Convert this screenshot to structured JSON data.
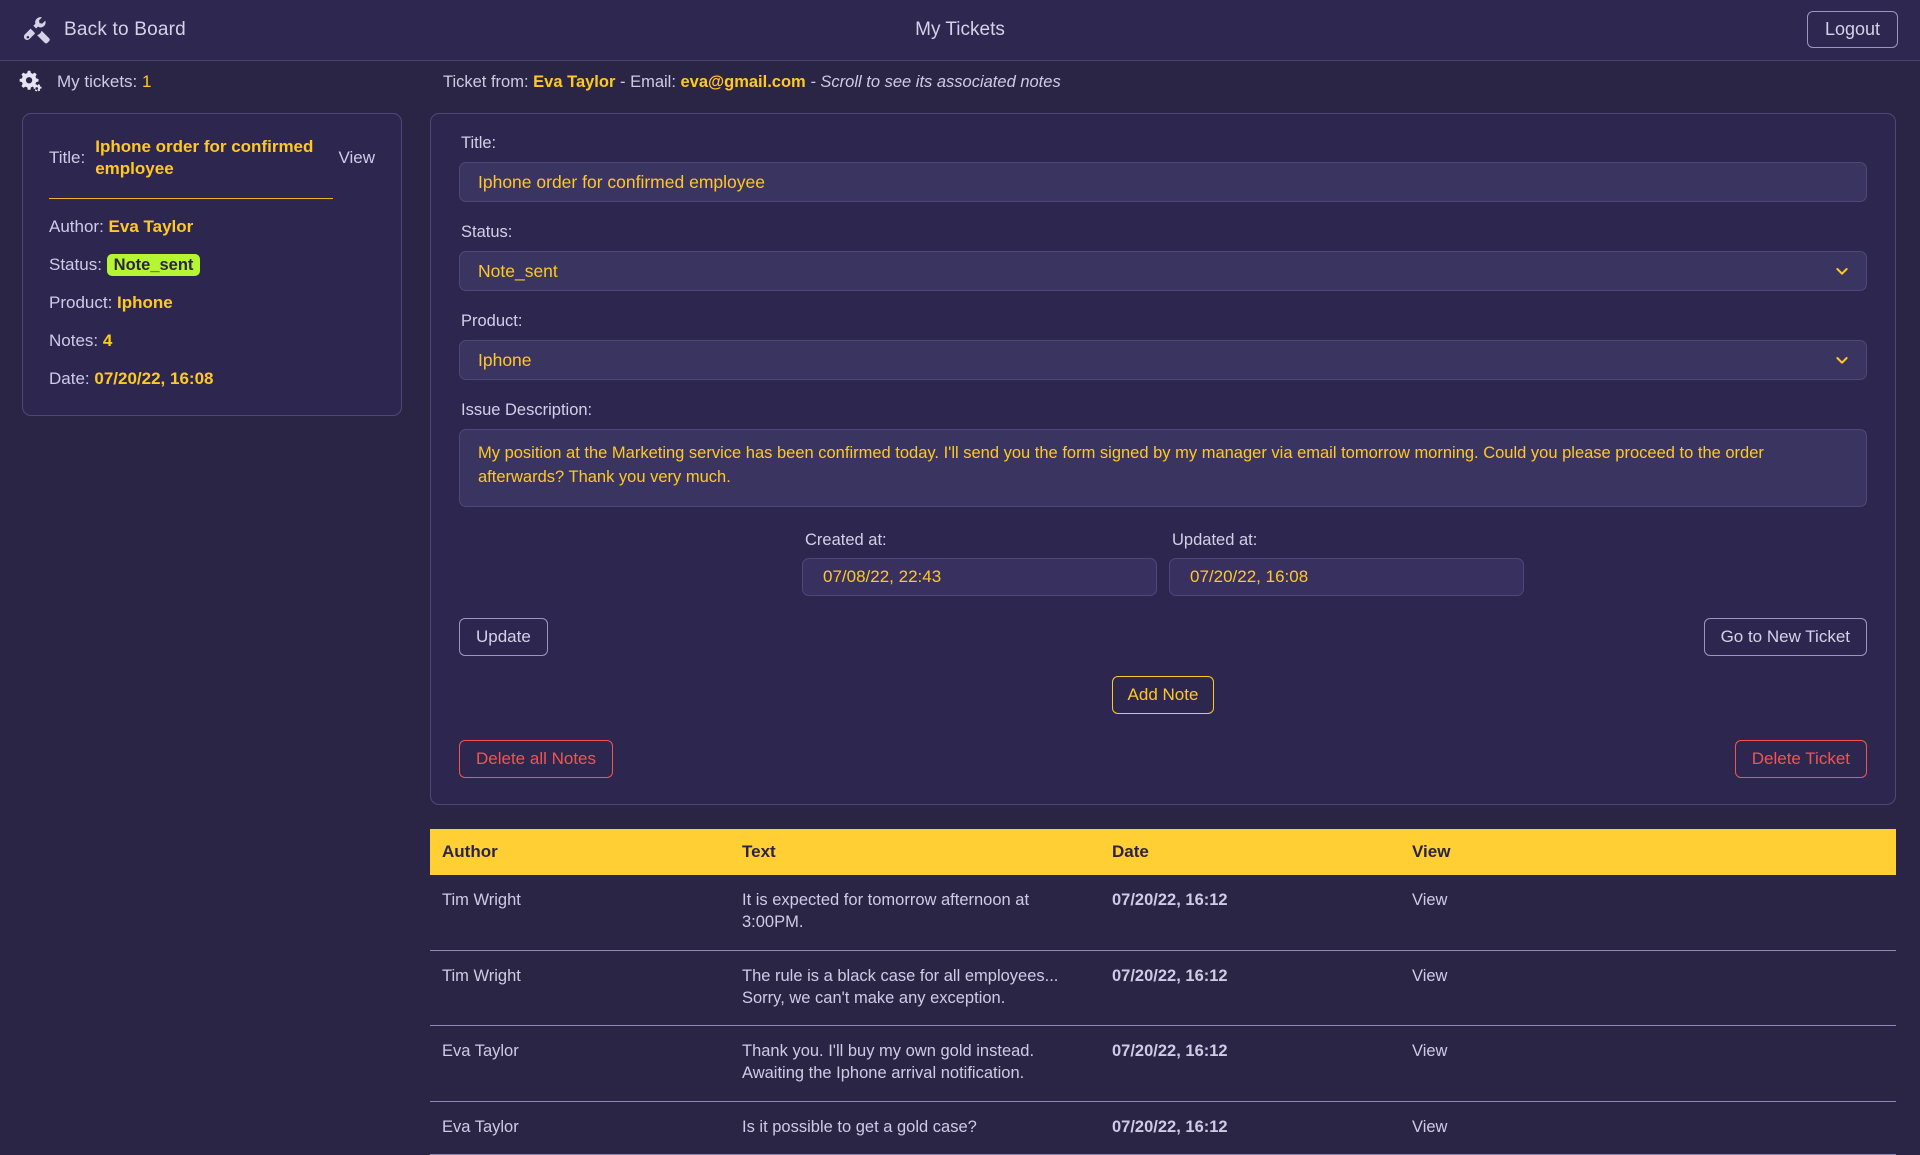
{
  "navbar": {
    "brand": "Back to Board",
    "title": "My Tickets",
    "logout_label": "Logout",
    "tools_icon": "tools-icon"
  },
  "subheader": {
    "gears_icon": "gears-icon",
    "my_tickets_label": "My tickets:",
    "my_tickets_count": "1",
    "ticket_from_prefix": "Ticket from:",
    "ticket_from_name": "Eva Taylor",
    "email_prefix": "- Email:",
    "email_value": "eva@gmail.com",
    "hint": "- Scroll to see its associated notes"
  },
  "sidebar": {
    "card": {
      "title_label": "Title:",
      "title_value": "Iphone order for confirmed employee",
      "view_label": "View",
      "author_label": "Author:",
      "author_value": "Eva Taylor",
      "status_label": "Status:",
      "status_value": "Note_sent",
      "product_label": "Product:",
      "product_value": "Iphone",
      "notes_label": "Notes:",
      "notes_value": "4",
      "date_label": "Date:",
      "date_value": "07/20/22, 16:08"
    }
  },
  "form": {
    "title_label": "Title:",
    "title_value": "Iphone order for confirmed employee",
    "status_label": "Status:",
    "status_value": "Note_sent",
    "status_options": [
      "Note_sent"
    ],
    "product_label": "Product:",
    "product_value": "Iphone",
    "product_options": [
      "Iphone"
    ],
    "description_label": "Issue Description:",
    "description_value": "My position at the Marketing service has been confirmed today. I'll send you the form signed by my manager via email tomorrow morning. Could you please proceed to the order afterwards? Thank you very much.",
    "created_at_label": "Created at:",
    "created_at_value": "07/08/22, 22:43",
    "updated_at_label": "Updated at:",
    "updated_at_value": "07/20/22, 16:08",
    "update_label": "Update",
    "go_new_ticket_label": "Go to New Ticket",
    "add_note_label": "Add Note",
    "delete_all_notes_label": "Delete all Notes",
    "delete_ticket_label": "Delete Ticket",
    "chevron_icon": "chevron-down-icon"
  },
  "notes_table": {
    "columns": [
      "Author",
      "Text",
      "Date",
      "View"
    ],
    "rows": [
      {
        "author": "Tim Wright",
        "text": "It is expected for tomorrow afternoon at 3:00PM.",
        "date": "07/20/22, 16:12",
        "view": "View"
      },
      {
        "author": "Tim Wright",
        "text": "The rule is a black case for all employees... Sorry, we can't make any exception.",
        "date": "07/20/22, 16:12",
        "view": "View"
      },
      {
        "author": "Eva Taylor",
        "text": "Thank you. I'll buy my own gold instead. Awaiting the Iphone arrival notification.",
        "date": "07/20/22, 16:12",
        "view": "View"
      },
      {
        "author": "Eva Taylor",
        "text": "Is it possible to get a gold case?",
        "date": "07/20/22, 16:12",
        "view": "View"
      }
    ]
  },
  "colors": {
    "page_bg": "#2b2545",
    "panel_bg": "#2d2750",
    "navbar_bg": "#2e2750",
    "accent_yellow": "#ffc824",
    "table_header_yellow": "#ffcf33",
    "status_green": "#b6f531",
    "danger_red": "#f4544e",
    "text_lavender": "#cfcbe6"
  }
}
